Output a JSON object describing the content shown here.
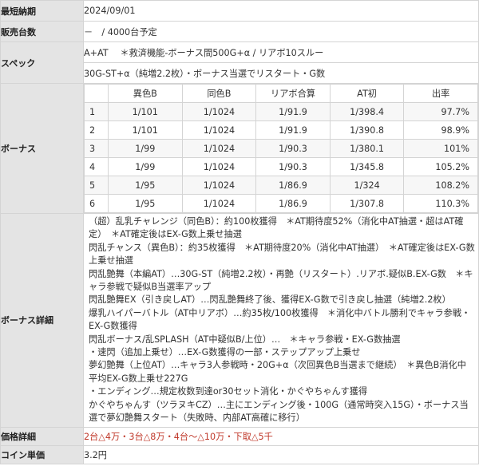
{
  "rows": {
    "release": {
      "label": "最短納期",
      "value": "2024/09/01"
    },
    "units": {
      "label": "販売台数",
      "value": "－　/ 4000台予定"
    },
    "spec": {
      "label": "スペック",
      "line1": "A+AT　 ＊救済機能-ボーナス間500G+α / リアボ10スルー",
      "line2": "30G-ST+α（純増2.2枚）・ボーナス当選でリスタート・G数"
    },
    "bonus": {
      "label": "ボーナス"
    },
    "bonus_detail": {
      "label": "ボーナス詳細",
      "text": "（超）乱乳チャレンジ（同色B）：約100枚獲得　＊AT期待度52%（消化中AT抽選・超はAT確定）　＊AT確定後はEX-G数上乗せ抽選\n閃乱チャンス（異色B）：約35枚獲得　＊AT期待度20%（消化中AT抽選）　＊AT確定後はEX-G数上乗せ抽選\n閃乱艶舞（本編AT）…30G-ST（純増2.2枚）・再艶（リスタート）.リアボ.疑似B.EX-G数　＊キャラ参戦で疑似B当選率アップ\n閃乱艶舞EX（引き戻しAT）…閃乱艶舞終了後、獲得EX-G数で引き戻し抽選（純増2.2枚）\n爆乳ハイパーバトル（AT中リアボ）…約35枚/100枚獲得　＊消化中バトル勝利でキャラ参戦・EX-G数獲得\n閃乱ボーナス/乱SPLASH（AT中疑似B/上位）…　＊キャラ参戦・EX-G数抽選\n・速閃（追加上乗せ）…EX-G数獲得の一部・ステップアップ上乗せ\n夢幻艶舞（上位AT）…キャラ3人参戦時・20G+α（次回異色B当選まで継続）　＊異色B消化中平均EX-G数上乗せ227G\n・エンディング…規定枚数到達or30セット消化・かぐやちゃんす獲得\nかぐやちゃんす（ツラヌキCZ）…主にエンディング後・100G（通常時突入15G）・ボーナス当選で夢幻艶舞スタート（失敗時、内部AT高確に移行）"
    },
    "price": {
      "label": "価格詳細",
      "value": "2台△4万・3台△8万・4台～△10万・下取△5千"
    },
    "coin": {
      "label": "コイン単価",
      "value": "3.2円"
    }
  },
  "bonus_table": {
    "headers": [
      "",
      "異色B",
      "同色B",
      "リアボ合算",
      "AT初",
      "出率"
    ],
    "rows": [
      [
        "1",
        "1/101",
        "1/1024",
        "1/91.9",
        "1/398.4",
        "97.7%"
      ],
      [
        "2",
        "1/101",
        "1/1024",
        "1/91.9",
        "1/390.8",
        "98.9%"
      ],
      [
        "3",
        "1/99",
        "1/1024",
        "1/90.3",
        "1/380.1",
        "101%"
      ],
      [
        "4",
        "1/99",
        "1/1024",
        "1/90.3",
        "1/345.8",
        "105.2%"
      ],
      [
        "5",
        "1/95",
        "1/1024",
        "1/86.9",
        "1/324",
        "108.2%"
      ],
      [
        "6",
        "1/95",
        "1/1024",
        "1/86.9",
        "1/307.8",
        "110.3%"
      ]
    ]
  },
  "colors": {
    "label_bg": "#e4e4e4",
    "border": "#d4d4d4",
    "price_text": "#c0392b"
  }
}
